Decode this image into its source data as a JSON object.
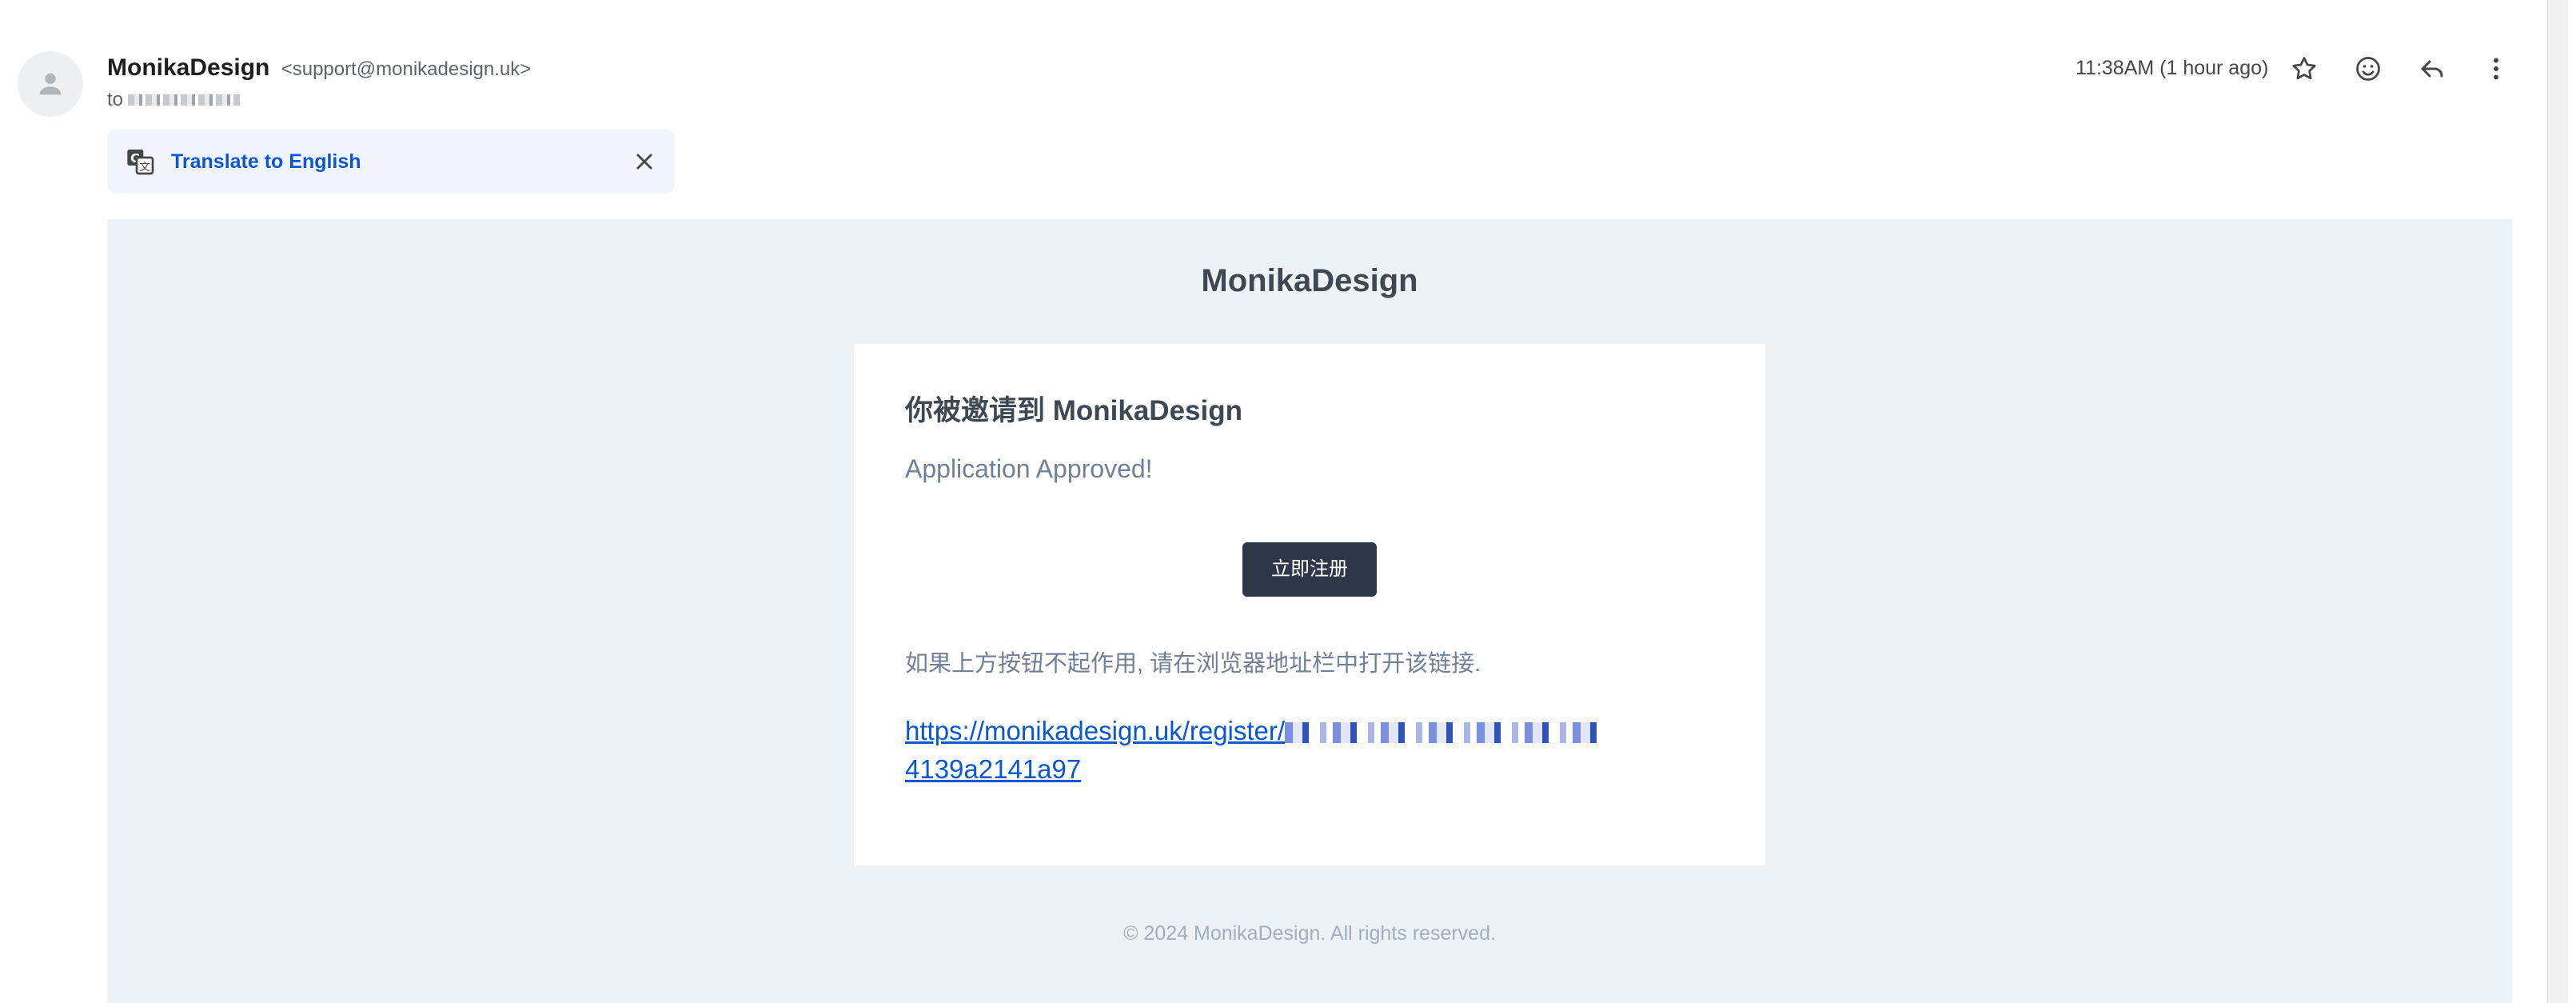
{
  "header": {
    "sender_name": "MonikaDesign",
    "sender_email": "<support@monikadesign.uk>",
    "to_prefix": "to",
    "time": "11:38AM (1 hour ago)"
  },
  "translate": {
    "label": "Translate to English"
  },
  "email": {
    "brand": "MonikaDesign",
    "title": "你被邀请到 MonikaDesign",
    "subtitle": "Application Approved!",
    "button_label": "立即注册",
    "note": "如果上方按钮不起作用, 请在浏览器地址栏中打开该链接.",
    "link_prefix": "https://monikadesign.uk/register/",
    "link_suffix": "4139a2141a97",
    "footer": "© 2024 MonikaDesign. All rights reserved."
  },
  "icons": {
    "avatar": "person-icon",
    "star": "star-icon",
    "emoji": "emoji-icon",
    "reply": "reply-icon",
    "more": "more-vert-icon",
    "translate": "translate-icon",
    "close": "close-icon"
  },
  "colors": {
    "link": "#0b57d0",
    "button_bg": "#2d3748",
    "email_bg": "#edf2f7"
  }
}
